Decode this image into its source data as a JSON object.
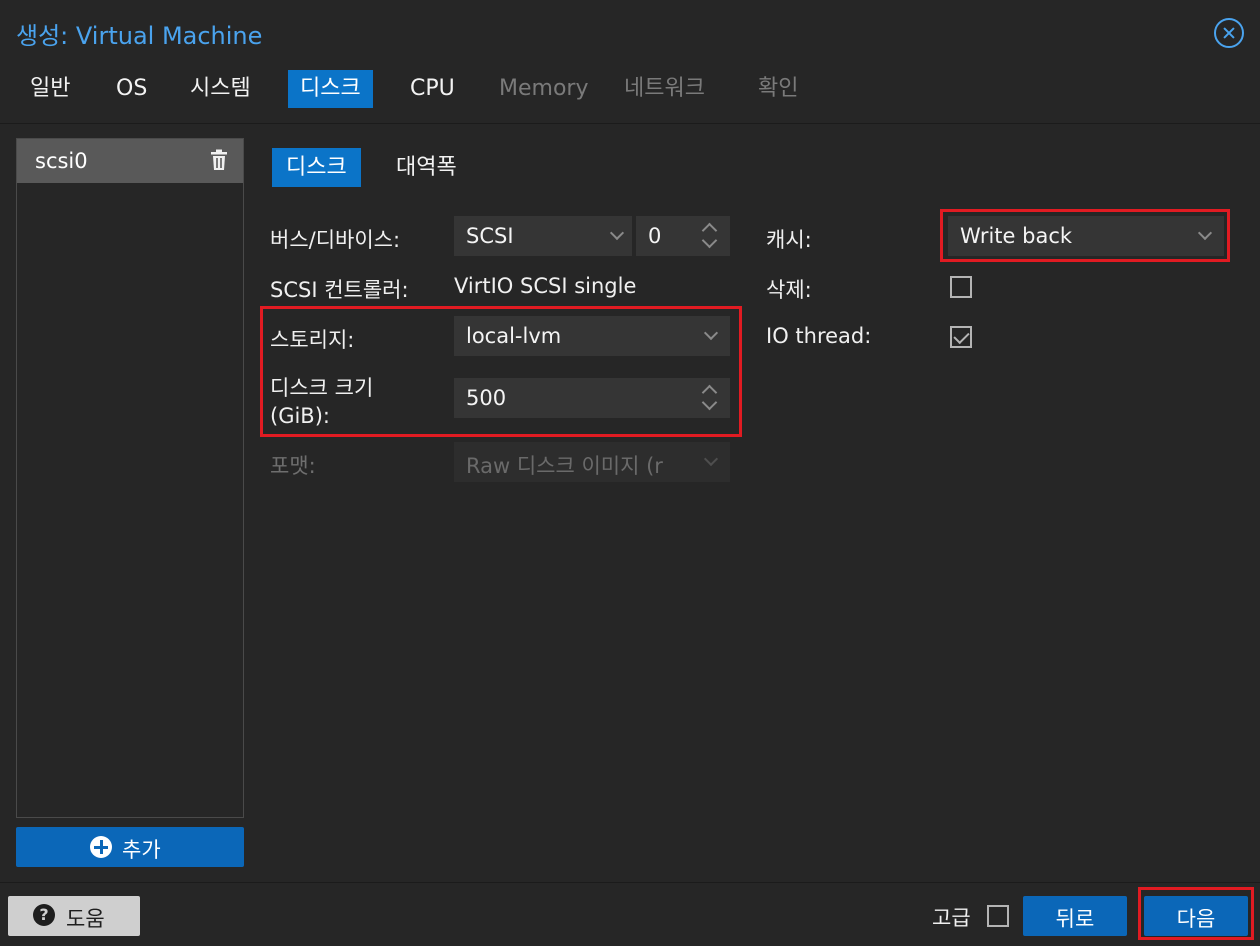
{
  "window": {
    "title_prefix": "생성:",
    "title_text": "Virtual Machine"
  },
  "tabs": [
    {
      "label": "일반",
      "state": "normal"
    },
    {
      "label": "OS",
      "state": "normal"
    },
    {
      "label": "시스템",
      "state": "normal"
    },
    {
      "label": "디스크",
      "state": "active"
    },
    {
      "label": "CPU",
      "state": "normal"
    },
    {
      "label": "Memory",
      "state": "disabled"
    },
    {
      "label": "네트워크",
      "state": "disabled"
    },
    {
      "label": "확인",
      "state": "disabled"
    }
  ],
  "disk_list": {
    "items": [
      {
        "label": "scsi0",
        "selected": true
      }
    ],
    "add_label": "추가"
  },
  "subtabs": [
    {
      "label": "디스크",
      "active": true
    },
    {
      "label": "대역폭",
      "active": false
    }
  ],
  "form": {
    "bus_device": {
      "label": "버스/디바이스:",
      "bus": "SCSI",
      "device_number": "0"
    },
    "scsi_controller": {
      "label": "SCSI 컨트롤러:",
      "value": "VirtIO SCSI single"
    },
    "storage": {
      "label": "스토리지:",
      "value": "local-lvm"
    },
    "disk_size": {
      "label_line1": "디스크 크기",
      "label_line2": "(GiB):",
      "value": "500"
    },
    "format": {
      "label": "포맷:",
      "value": "Raw 디스크 이미지 (r"
    },
    "cache": {
      "label": "캐시:",
      "value": "Write back"
    },
    "discard": {
      "label": "삭제:",
      "checked": false
    },
    "io_thread": {
      "label": "IO thread:",
      "checked": true
    }
  },
  "footer": {
    "help_label": "도움",
    "help_glyph": "?",
    "advanced_label": "고급",
    "advanced_checked": false,
    "back_label": "뒤로",
    "next_label": "다음"
  },
  "colors": {
    "accent": "#0b74c8",
    "title": "#4aa3ee",
    "highlight": "#e11b22",
    "background": "#262626"
  }
}
